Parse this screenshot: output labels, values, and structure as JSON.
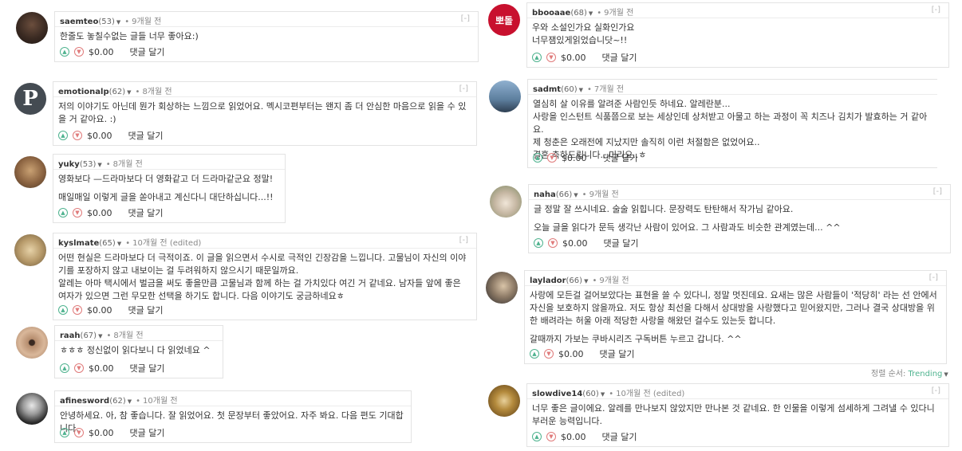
{
  "time_suffix": "전",
  "collapse_label": "[-]",
  "reply_label": "댓글 달기",
  "sort": {
    "label": "정렬 순서:",
    "value": "Trending"
  },
  "left_comments": [
    {
      "user": "saemteo",
      "rep": "(53)",
      "time": "9개월",
      "edited": "",
      "lines": [
        "한줄도 놓칠수없는 글들 너무 좋아요:)"
      ],
      "payout": "$0.00"
    },
    {
      "user": "emotionalp",
      "rep": "(62)",
      "time": "8개월",
      "edited": "",
      "lines": [
        "저의 이야기도 아닌데 뭔가 회상하는 느낌으로 읽었어요. 멕시코편부터는 왠지 좀 더 안심한 마음으로 읽을 수 있을 거 같아요. :)"
      ],
      "payout": "$0.00"
    },
    {
      "user": "yuky",
      "rep": "(53)",
      "time": "8개월",
      "edited": "",
      "lines": [
        "영화보다 —드라마보다 더 영화같고 더 드라마같군요 정말!",
        "매일매일 이렇게 글을 쏟아내고 계신다니 대단하십니다...!!"
      ],
      "payout": "$0.00"
    },
    {
      "user": "kyslmate",
      "rep": "(65)",
      "time": "10개월",
      "edited": "(edited)",
      "lines": [
        "어떤 현실은 드라마보다 더 극적이죠. 이 글을 읽으면서 수시로 극적인 긴장감을 느낍니다. 고물님이 자신의 이야기를 포장하지 않고 내보이는 걸 두려워하지 않으시기 때문일까요.",
        "알레는 아마 택시에서 벌금을 써도 좋을만큼 고물님과 함께 하는 걸 가치있다 여긴 거 같네요. 남자들 앞에 좋은 여자가 있으면 그런 무모한 선택을 하기도 합니다. 다음 이야기도 궁금하네요ㅎ"
      ],
      "payout": "$0.00"
    },
    {
      "user": "raah",
      "rep": "(67)",
      "time": "8개월",
      "edited": "",
      "lines": [
        "ㅎㅎㅎ 정신없이 읽다보니 다 읽었네요 ^"
      ],
      "payout": "$0.00"
    },
    {
      "user": "afinesword",
      "rep": "(62)",
      "time": "10개월",
      "edited": "",
      "lines": [
        "안녕하세요. 아, 참 좋습니다. 잘 읽었어요. 첫 문장부터 좋았어요. 자주 봐요. 다음 편도 기대합니다."
      ],
      "payout": "$0.00"
    }
  ],
  "right_comments": [
    {
      "user": "bbooaae",
      "rep": "(68)",
      "time": "9개월",
      "edited": "",
      "lines": [
        "우와 소설인가요 실화인가요",
        "너무잼있게읽었습니닷~!!"
      ],
      "payout": "$0.00",
      "avatar_text": "뽀돌"
    },
    {
      "user": "sadmt",
      "rep": "(60)",
      "time": "7개월",
      "edited": "",
      "lines": [
        "열심히 살 이유를 알려준 사람인듯 하네요. 알레란분...",
        "사랑을 인스턴트 식품쯤으로 보는 세상인데 상처받고 아물고 하는 과정이 꼭 치즈나 김치가 발효하는 거 같아요.",
        "제 청춘은 오래전에 지났지만 솔직히 이런 처절함은 없었어요..",
        "결혼 축하드립니다...미리요..ㅎ"
      ],
      "payout": "$0.00"
    },
    {
      "user": "naha",
      "rep": "(66)",
      "time": "9개월",
      "edited": "",
      "lines": [
        "글 정말 잘 쓰시네요. 술술 읽힙니다. 문장력도 탄탄해서 작가님 같아요.",
        "오늘 글을 읽다가 문득 생각난 사람이 있어요. 그 사람과도 비슷한 관계였는데... ^^"
      ],
      "payout": "$0.00"
    },
    {
      "user": "laylador",
      "rep": "(66)",
      "time": "9개월",
      "edited": "",
      "lines": [
        "사랑에 모든걸 걸어보았다는 표현을 쓸 수 있다니, 정말 멋진데요. 요새는 많은 사람들이 '적당히' 라는 선 안에서 자신을 보호하지 않을까요. 저도 항상 최선을 다해서 상대방을 사랑했다고 믿어왔지만, 그러나 결국 상대방을 위한 배려라는 허울 아래 적당한 사랑을 해왔던 걸수도 있는듯 합니다.",
        "갈때까지 가보는 쿠바시리즈 구독버튼 누르고 갑니다. ^^"
      ],
      "payout": "$0.00"
    },
    {
      "user": "slowdive14",
      "rep": "(60)",
      "time": "10개월",
      "edited": "(edited)",
      "lines": [
        "너무 좋은 글이에요. 알레를 만나보지 않았지만 만나본 것 같네요. 한 인물을 이렇게 섬세하게 그려낼 수 있다니 부러운 능력입니다."
      ],
      "payout": "$0.00"
    }
  ]
}
